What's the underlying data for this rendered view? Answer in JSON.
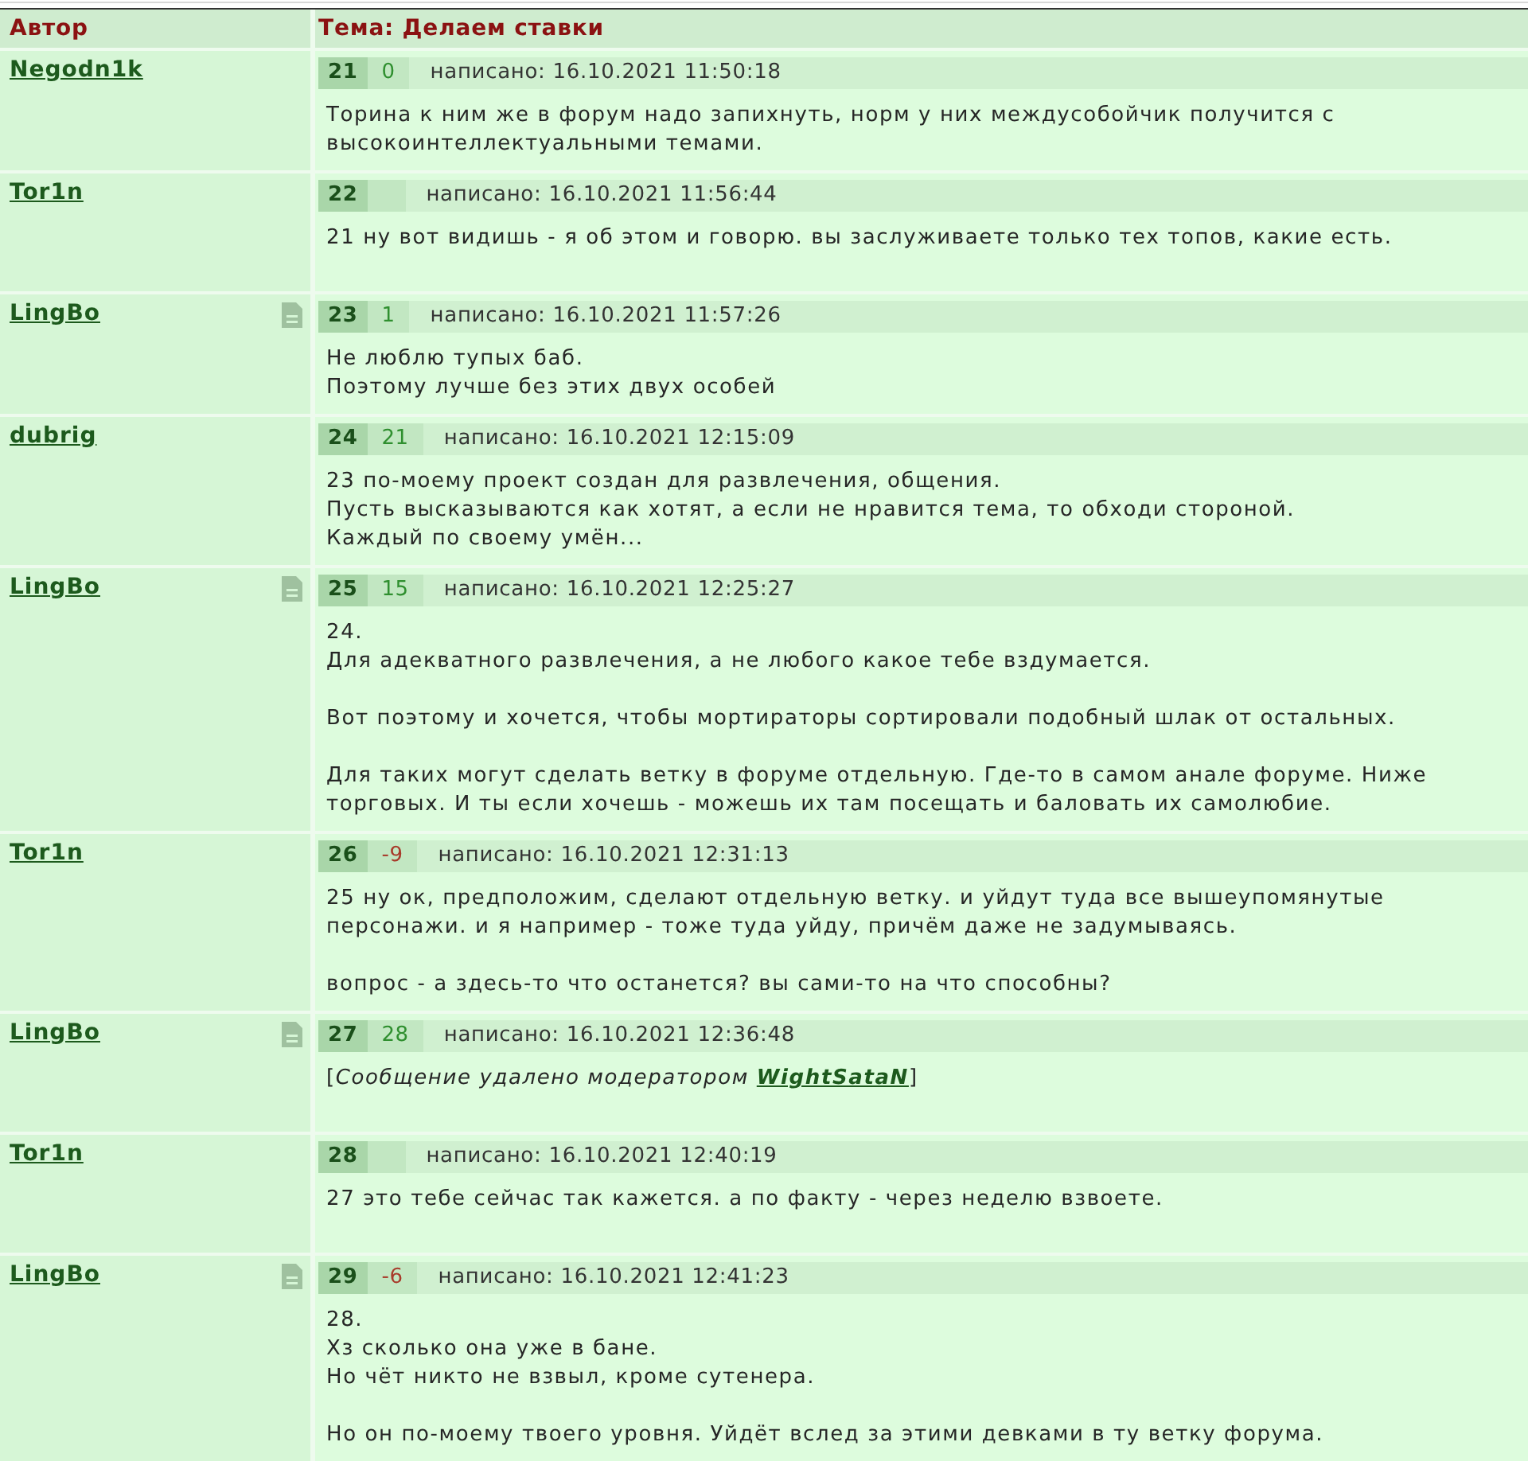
{
  "columns": {
    "author": "Автор",
    "topic": "Тема: Делаем ставки"
  },
  "posts": [
    {
      "author": "Negodn1k",
      "doc_icon": false,
      "number": "21",
      "rating": {
        "text": "0",
        "color": "#2f8f2f"
      },
      "written": "написано: 16.10.2021 11:50:18",
      "body": {
        "kind": "text",
        "paragraphs": [
          "Торина к ним же в форум надо запихнуть, норм у них междусобойчик получится с высокоинтеллектуальными темами."
        ]
      }
    },
    {
      "author": "Tor1n",
      "doc_icon": false,
      "number": "22",
      "written": "написано: 16.10.2021 11:56:44",
      "body": {
        "kind": "text",
        "paragraphs": [
          "21 ну вот видишь - я об этом и говорю. вы заслуживаете только тех топов, какие есть."
        ]
      }
    },
    {
      "author": "LingBo",
      "doc_icon": true,
      "number": "23",
      "rating": {
        "text": "1",
        "color": "#2f8f2f"
      },
      "written": "написано: 16.10.2021 11:57:26",
      "body": {
        "kind": "text",
        "paragraphs": [
          "Не люблю тупых баб.\nПоэтому лучше без этих двух особей"
        ]
      }
    },
    {
      "author": "dubrig",
      "doc_icon": false,
      "number": "24",
      "rating": {
        "text": "21",
        "color": "#2f8f2f"
      },
      "written": "написано: 16.10.2021 12:15:09",
      "body": {
        "kind": "text",
        "paragraphs": [
          "23 по-моему проект создан для развлечения, общения.\nПусть высказываются как хотят, а если не нравится тема, то обходи стороной.\nКаждый по своему умён..."
        ]
      }
    },
    {
      "author": "LingBo",
      "doc_icon": true,
      "number": "25",
      "rating": {
        "text": "15",
        "color": "#2f8f2f"
      },
      "written": "написано: 16.10.2021 12:25:27",
      "body": {
        "kind": "text",
        "paragraphs": [
          "24.\nДля адекватного развлечения, а не любого какое тебе вздумается.",
          "Вот поэтому и хочется, чтобы мортираторы сортировали подобный шлак от остальных.",
          "Для таких могут сделать ветку в форуме отдельную. Где-то в самом анале форуме. Ниже торговых. И ты если хочешь - можешь их там посещать и баловать их самолюбие."
        ]
      }
    },
    {
      "author": "Tor1n",
      "doc_icon": false,
      "number": "26",
      "rating": {
        "text": "-9",
        "color": "#a83a2a"
      },
      "written": "написано: 16.10.2021 12:31:13",
      "body": {
        "kind": "text",
        "paragraphs": [
          "25 ну ок, предположим, сделают отдельную ветку. и уйдут туда все вышеупомянутые персонажи. и я например - тоже туда уйду, причём даже не задумываясь.",
          "вопрос - а здесь-то что останется? вы сами-то на что способны?"
        ]
      }
    },
    {
      "author": "LingBo",
      "doc_icon": true,
      "number": "27",
      "rating": {
        "text": "28",
        "color": "#2f8f2f"
      },
      "written": "написано: 16.10.2021 12:36:48",
      "body": {
        "kind": "deleted",
        "before": "[*Сообщение удалено модератором* ",
        "moderator": "WightSataN",
        "after": "]"
      }
    },
    {
      "author": "Tor1n",
      "doc_icon": false,
      "number": "28",
      "written": "написано: 16.10.2021 12:40:19",
      "body": {
        "kind": "text",
        "paragraphs": [
          "27 это тебе сейчас так кажется. а по факту - через неделю взвоете."
        ]
      }
    },
    {
      "author": "LingBo",
      "doc_icon": true,
      "number": "29",
      "rating": {
        "text": "-6",
        "color": "#a83a2a"
      },
      "written": "написано: 16.10.2021 12:41:23",
      "body": {
        "kind": "text",
        "paragraphs": [
          "28.\nХз сколько она уже в бане.\nНо чёт никто не взвыл, кроме сутенера.",
          "Но он по-моему твоего уровня. Уйдёт вслед за этими девками в ту ветку форума."
        ]
      }
    }
  ]
}
